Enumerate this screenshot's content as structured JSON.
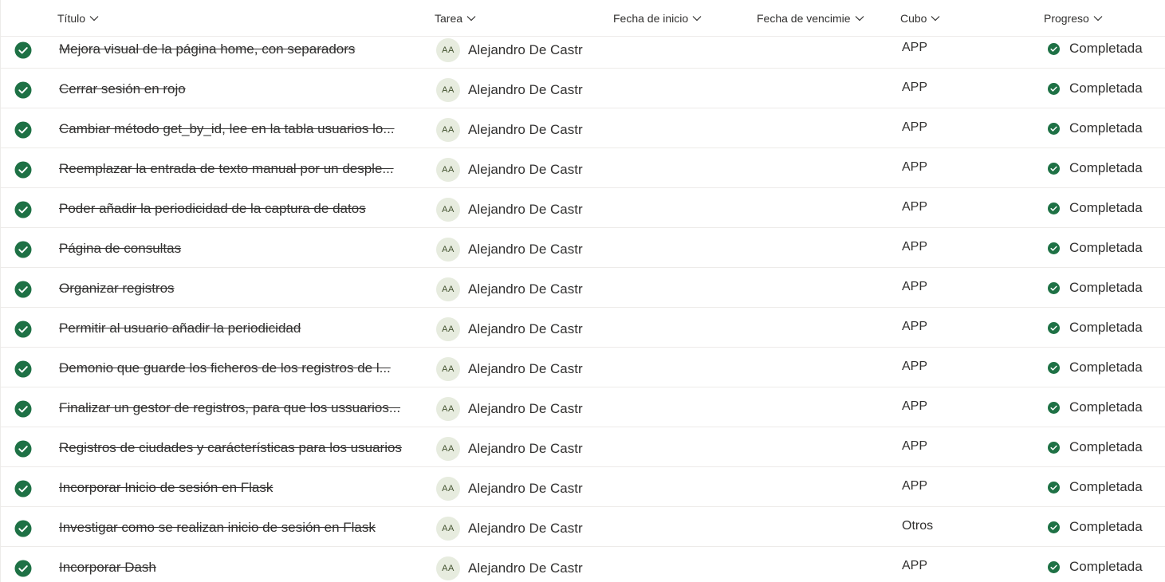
{
  "columns": {
    "title": "Título",
    "task": "Tarea",
    "start_date": "Fecha de inicio",
    "due_date": "Fecha de vencimie",
    "bucket": "Cubo",
    "progress": "Progreso"
  },
  "colors": {
    "complete_green": "#1e7145",
    "avatar_bg": "#e7ecdf",
    "avatar_text": "#43522f",
    "divider": "#edebe9"
  },
  "icons": {
    "sort": "chevron-down-icon",
    "row_check": "check-circle-icon",
    "progress": "check-circle-icon"
  },
  "tasks": [
    {
      "title": "Mejora visual de la página home, con separadors",
      "avatar": "AA",
      "assignee": "Alejandro De Castr",
      "bucket": "APP",
      "progress": "Completada"
    },
    {
      "title": "Cerrar sesión en rojo",
      "avatar": "AA",
      "assignee": "Alejandro De Castr",
      "bucket": "APP",
      "progress": "Completada"
    },
    {
      "title": "Cambiar método get_by_id, lee en la tabla usuarios lo...",
      "avatar": "AA",
      "assignee": "Alejandro De Castr",
      "bucket": "APP",
      "progress": "Completada"
    },
    {
      "title": "Reemplazar la entrada de texto manual por un desple...",
      "avatar": "AA",
      "assignee": "Alejandro De Castr",
      "bucket": "APP",
      "progress": "Completada"
    },
    {
      "title": "Poder añadir la periodicidad de la captura de datos",
      "avatar": "AA",
      "assignee": "Alejandro De Castr",
      "bucket": "APP",
      "progress": "Completada"
    },
    {
      "title": "Página de consultas",
      "avatar": "AA",
      "assignee": "Alejandro De Castr",
      "bucket": "APP",
      "progress": "Completada"
    },
    {
      "title": "Organizar registros",
      "avatar": "AA",
      "assignee": "Alejandro De Castr",
      "bucket": "APP",
      "progress": "Completada"
    },
    {
      "title": "Permitir al usuario añadir la periodicidad",
      "avatar": "AA",
      "assignee": "Alejandro De Castr",
      "bucket": "APP",
      "progress": "Completada"
    },
    {
      "title": "Demonio que guarde los ficheros de los registros de l...",
      "avatar": "AA",
      "assignee": "Alejandro De Castr",
      "bucket": "APP",
      "progress": "Completada"
    },
    {
      "title": "Finalizar un gestor de registros, para que los ussuarios...",
      "avatar": "AA",
      "assignee": "Alejandro De Castr",
      "bucket": "APP",
      "progress": "Completada"
    },
    {
      "title": "Registros de ciudades y carácterísticas para los usuarios",
      "avatar": "AA",
      "assignee": "Alejandro De Castr",
      "bucket": "APP",
      "progress": "Completada"
    },
    {
      "title": "Incorporar Inicio de sesión en Flask",
      "avatar": "AA",
      "assignee": "Alejandro De Castr",
      "bucket": "APP",
      "progress": "Completada"
    },
    {
      "title": "Investigar como se realizan inicio de sesión en Flask",
      "avatar": "AA",
      "assignee": "Alejandro De Castr",
      "bucket": "Otros",
      "progress": "Completada"
    },
    {
      "title": "Incorporar Dash",
      "avatar": "AA",
      "assignee": "Alejandro De Castr",
      "bucket": "APP",
      "progress": "Completada"
    }
  ]
}
